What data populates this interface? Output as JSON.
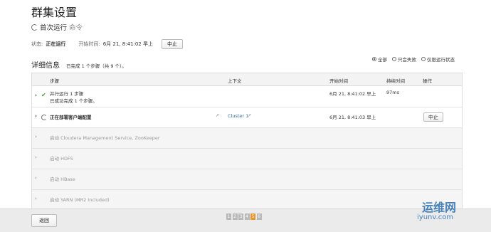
{
  "page_title": "群集设置",
  "subtitle": {
    "label": "首次运行",
    "cmd": "命令"
  },
  "status": {
    "state_label": "状态:",
    "state_value": "正在运行",
    "start_label": "开始时间:",
    "start_value": "6月 21, 8:41:02 早上",
    "stop_button": "中止"
  },
  "details": {
    "heading": "详细信息",
    "summary": "已完成 1 个步骤（共 9 个）。"
  },
  "filters": [
    {
      "label": "全部",
      "selected": true
    },
    {
      "label": "只会失败",
      "selected": false
    },
    {
      "label": "仅限运行状态",
      "selected": false
    }
  ],
  "table": {
    "headers": {
      "step": "步骤",
      "context": "上下文",
      "start": "开始时间",
      "duration": "持续时间",
      "actions": "操作"
    },
    "row1": {
      "step": "并行运行 1 步骤",
      "detail": "已成功完成 1 个步骤。",
      "start": "6月 21, 8:41:02 早上",
      "duration": "97ms"
    },
    "row2": {
      "step": "正在部署客户端配置",
      "context": "Cluster 1",
      "start": "6月 21, 8:41:03 早上",
      "action": "中止"
    },
    "pending": [
      "启动 Cloudera Management Service, ZooKeeper",
      "启动 HDFS",
      "启动 HBase",
      "启动 YARN (MR2 Included)"
    ]
  },
  "footer": {
    "back_button": "返回",
    "pages": [
      "1",
      "2",
      "3",
      "4",
      "5",
      "6"
    ],
    "current_page": "5"
  },
  "watermark": {
    "line1": "运维网",
    "line2": "iyunv.com"
  },
  "colors": {
    "accent": "#e9962e",
    "link": "#2a6fb0",
    "success": "#4a9c3a"
  }
}
